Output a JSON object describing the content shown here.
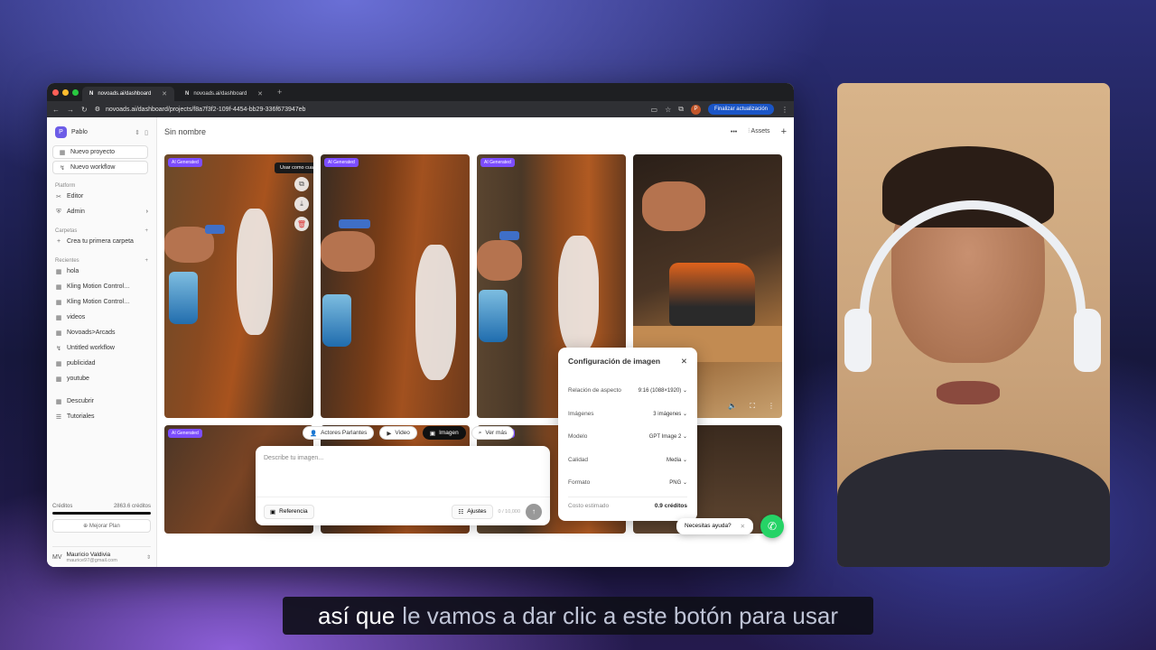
{
  "browser": {
    "tabs": [
      {
        "label": "novoads.ai/dashboard",
        "active": true
      },
      {
        "label": "novoads.ai/dashboard",
        "active": false
      }
    ],
    "url": "novoads.ai/dashboard/projects/f8a7f3f2-109f-4454-bb29-336f673947eb",
    "update_button": "Finalizar actualización"
  },
  "sidebar": {
    "workspace_initial": "P",
    "workspace_name": "Pablo",
    "new_project": "Nuevo proyecto",
    "new_workflow": "Nuevo workflow",
    "platform_label": "Platform",
    "platform_items": [
      "Editor",
      "Admin"
    ],
    "folders_label": "Carpetas",
    "create_folder": "Crea tu primera carpeta",
    "recent_label": "Recientes",
    "recent_items": [
      "hola",
      "Kling Motion Control…",
      "Kling Motion Control…",
      "videos",
      "Novoads>Arcads",
      "Untitled workflow",
      "publicidad",
      "youtube"
    ],
    "discover": "Descubrir",
    "tutorials": "Tutoriales",
    "credits_label": "Créditos",
    "credits_value": "2863.6 créditos",
    "upgrade": "Mejorar Plan",
    "user_initials": "MV",
    "user_name": "Mauricio Valdivia",
    "user_email": "maurice97@gmail.com"
  },
  "main": {
    "title": "Sin nombre",
    "assets": "Assets",
    "badge": "AI Generated",
    "tooltip": "Usar como cuadro inicial",
    "mode_pills": [
      "Actores Parlantes",
      "Video",
      "Imagen",
      "Ver más"
    ],
    "active_mode": "Imagen",
    "prompt_placeholder": "Describe tu imagen...",
    "reference_button": "Referencia",
    "settings_button": "Ajustes",
    "char_count": "0 / 10,000"
  },
  "config": {
    "title": "Configuración de imagen",
    "rows": [
      {
        "label": "Relación de aspecto",
        "value": "9:16 (1088×1920)"
      },
      {
        "label": "Imágenes",
        "value": "3 imágenes"
      },
      {
        "label": "Modelo",
        "value": "GPT Image 2"
      },
      {
        "label": "Calidad",
        "value": "Media"
      },
      {
        "label": "Formato",
        "value": "PNG"
      }
    ],
    "cost_label": "Costo estimado",
    "cost_value": "0.9 créditos"
  },
  "help": {
    "label": "Necesitas ayuda?"
  },
  "subtitle": {
    "highlight": "así que",
    "rest": "le vamos a dar clic a este botón para usar"
  },
  "colors": {
    "accent": "#7c4dff",
    "update": "#1a55c7",
    "whatsapp": "#25d366"
  }
}
